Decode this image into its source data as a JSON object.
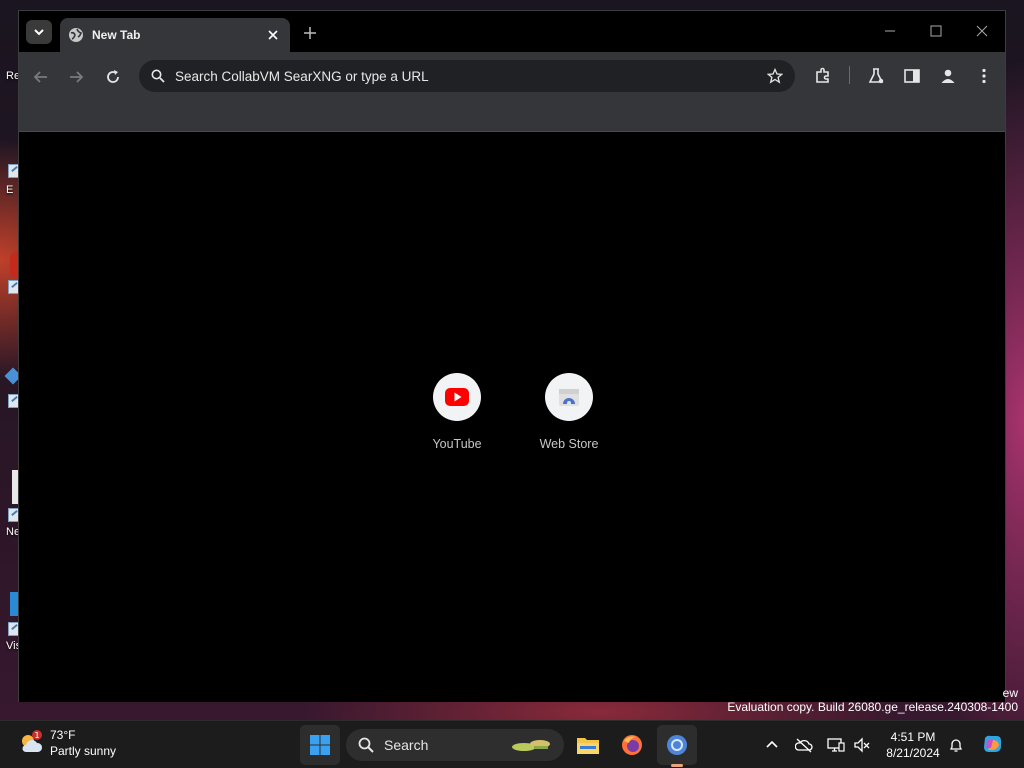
{
  "browser": {
    "tab": {
      "title": "New Tab"
    },
    "omnibox": {
      "placeholder": "Search CollabVM SearXNG or type a URL"
    },
    "shortcuts": [
      {
        "label": "YouTube"
      },
      {
        "label": "Web Store"
      }
    ]
  },
  "desktop": {
    "icon_labels": [
      "Re",
      "E",
      "Ne",
      "Vis"
    ],
    "watermark_line1": "ew",
    "watermark_line2": "Evaluation copy. Build 26080.ge_release.240308-1400"
  },
  "taskbar": {
    "weather": {
      "temp": "73°F",
      "condition": "Partly sunny",
      "badge": "1"
    },
    "search": {
      "label": "Search"
    },
    "clock": {
      "time": "4:51 PM",
      "date": "8/21/2024"
    }
  },
  "colors": {
    "tab_active": "#35363a",
    "toolbar": "#35363a",
    "omnibox": "#202124",
    "youtube_red": "#ff0000",
    "taskbar": "#1c1c1c"
  }
}
